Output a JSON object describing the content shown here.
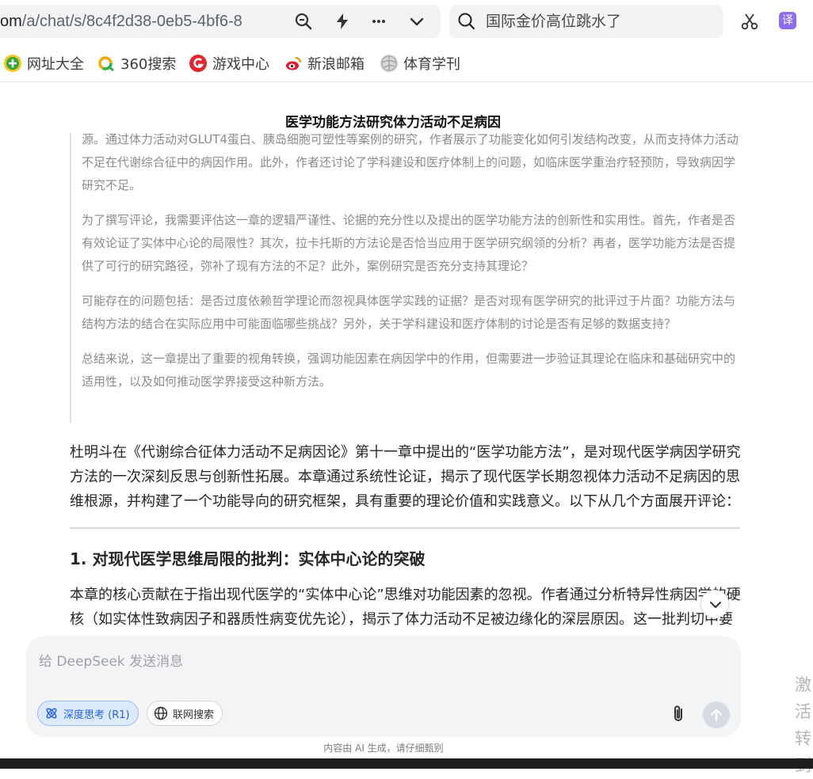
{
  "browser": {
    "url_host": "om",
    "url_path": "/a/chat/s/8c4f2d38-0eb5-4bf6-8",
    "search_text": "国际金价高位跳水了",
    "translate_label": "译"
  },
  "bookmarks": [
    {
      "label": "网址大全",
      "icon": "nav-plus-icon"
    },
    {
      "label": "360搜索",
      "icon": "360-search-icon"
    },
    {
      "label": "游戏中心",
      "icon": "game-center-icon"
    },
    {
      "label": "新浪邮箱",
      "icon": "sina-mail-icon"
    },
    {
      "label": "体育学刊",
      "icon": "sports-journal-icon"
    }
  ],
  "doc": {
    "title": "医学功能方法研究体力活动不足病因",
    "thinking": [
      "源。通过体力活动对GLUT4蛋白、胰岛细胞可塑性等案例的研究，作者展示了功能变化如何引发结构改变，从而支持体力活动不足在代谢综合征中的病因作用。此外，作者还讨论了学科建设和医疗体制上的问题，如临床医学重治疗轻预防，导致病因学研究不足。",
      "为了撰写评论，我需要评估这一章的逻辑严谨性、论据的充分性以及提出的医学功能方法的创新性和实用性。首先，作者是否有效论证了实体中心论的局限性？其次，拉卡托斯的方法论是否恰当应用于医学研究纲领的分析？再者，医学功能方法是否提供了可行的研究路径，弥补了现有方法的不足？此外，案例研究是否充分支持其理论？",
      "可能存在的问题包括：是否过度依赖哲学理论而忽视具体医学实践的证据？是否对现有医学研究的批评过于片面？功能方法与结构方法的结合在实际应用中可能面临哪些挑战？另外，关于学科建设和医疗体制的讨论是否有足够的数据支持？",
      "总结来说，这一章提出了重要的视角转换，强调功能因素在病因学中的作用，但需要进一步验证其理论在临床和基础研究中的适用性，以及如何推动医学界接受这种新方法。"
    ],
    "answer_intro": "杜明斗在《代谢综合征体力活动不足病因论》第十一章中提出的“医学功能方法”，是对现代医学病因学研究方法的一次深刻反思与创新性拓展。本章通过系统性论证，揭示了现代医学长期忽视体力活动不足病因的思维根源，并构建了一个功能导向的研究框架，具有重要的理论价值和实践意义。以下从几个方面展开评论：",
    "section1_heading": "1. 对现代医学思维局限的批判：实体中心论的突破",
    "section1_text": "本章的核心贡献在于指出现代医学的“实体中心论”思维对功能因素的忽视。作者通过分析特异性病因学的硬核（如实体性致病因子和器质性病变优先论），揭示了体力活动不足被边缘化的深层原因。这一批判切中要"
  },
  "composer": {
    "placeholder": "给 DeepSeek 发送消息",
    "deep_think_label": "深度思考 (R1)",
    "web_search_label": "联网搜索"
  },
  "footer": {
    "disclaimer": "内容由 AI 生成，请仔细甄别",
    "side_text": "激活转到"
  }
}
